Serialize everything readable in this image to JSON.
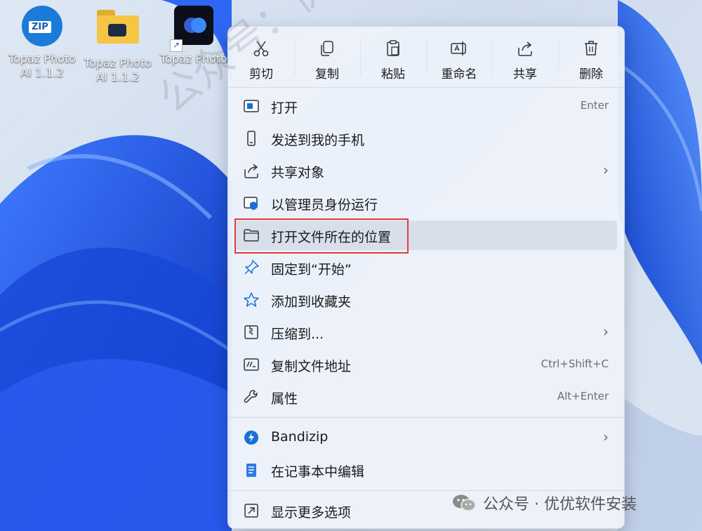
{
  "desktop": {
    "icons": [
      {
        "line1": "Topaz Photo",
        "line2": "AI 1.1.2"
      },
      {
        "line1": "Topaz Photo",
        "line2": "AI 1.1.2"
      },
      {
        "line1": "Topaz Photo",
        "line2": ""
      }
    ],
    "zip_tag": "ZIP"
  },
  "toolbar": [
    {
      "label": "剪切",
      "icon": "scissors-icon"
    },
    {
      "label": "复制",
      "icon": "copy-icon"
    },
    {
      "label": "粘贴",
      "icon": "paste-icon"
    },
    {
      "label": "重命名",
      "icon": "rename-icon"
    },
    {
      "label": "共享",
      "icon": "share-icon"
    },
    {
      "label": "删除",
      "icon": "trash-icon"
    }
  ],
  "menu_items": [
    {
      "label": "打开",
      "shortcut": "Enter",
      "icon": "open-app-icon"
    },
    {
      "label": "发送到我的手机",
      "icon": "phone-icon"
    },
    {
      "label": "共享对象",
      "submenu": "›",
      "icon": "share-icon"
    },
    {
      "label": "以管理员身份运行",
      "icon": "admin-shield-icon"
    },
    {
      "label": "打开文件所在的位置",
      "icon": "folder-icon"
    },
    {
      "label": "固定到“开始”",
      "icon": "pin-icon"
    },
    {
      "label": "添加到收藏夹",
      "icon": "star-icon"
    },
    {
      "label": "压缩到...",
      "submenu": "›",
      "icon": "zip-icon"
    },
    {
      "label": "复制文件地址",
      "shortcut": "Ctrl+Shift+C",
      "icon": "path-icon"
    },
    {
      "label": "属性",
      "shortcut": "Alt+Enter",
      "icon": "wrench-icon"
    },
    {
      "label": "Bandizip",
      "submenu": "›",
      "icon": "bandizip-icon"
    },
    {
      "label": "在记事本中编辑",
      "icon": "notepad-icon"
    },
    {
      "label": "显示更多选项",
      "icon": "more-options-icon"
    }
  ],
  "watermark": {
    "diagonal": "公众号：优优软件安装",
    "bottom": "公众号 · 优优软件安装"
  },
  "colors": {
    "highlight": "#e23b3b",
    "accent": "#1a6fd6"
  }
}
